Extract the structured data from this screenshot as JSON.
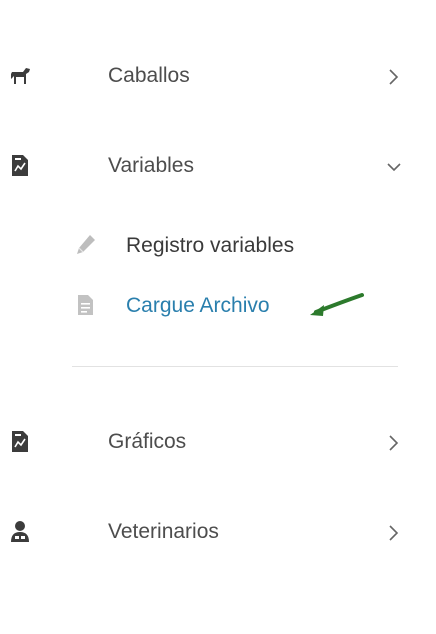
{
  "header": {
    "partial_text": ""
  },
  "menu": [
    {
      "label": "Caballos",
      "icon": "horse-icon",
      "chevron": "chevron-right-icon"
    },
    {
      "label": "Variables",
      "icon": "document-chart-icon",
      "chevron": "chevron-down-icon"
    },
    {
      "label": "Gráficos",
      "icon": "chart-file-icon",
      "chevron": "chevron-right-icon"
    },
    {
      "label": "Veterinarios",
      "icon": "doctor-icon",
      "chevron": "chevron-right-icon"
    }
  ],
  "submenu": [
    {
      "label": "Registro variables",
      "icon": "pencil-icon"
    },
    {
      "label": "Cargue Archivo",
      "icon": "file-icon",
      "active": true
    }
  ],
  "colors": {
    "active": "#2a7fad",
    "arrow": "#2c7a2c",
    "text": "#4d4d4d",
    "icon": "#3c3c3c"
  }
}
